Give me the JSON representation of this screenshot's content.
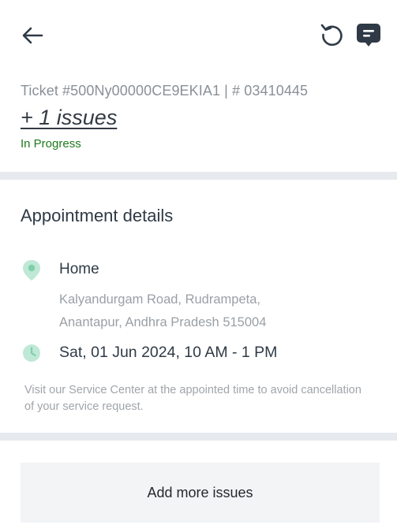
{
  "header": {
    "back_icon": "arrow-left-icon",
    "refresh_icon": "refresh-icon",
    "chat_icon": "chat-bubble-icon"
  },
  "ticket": {
    "id_text": "Ticket #500Ny00000CE9EKIA1 | # 03410445",
    "issues_link": "+ 1 issues",
    "status": "In Progress",
    "status_color": "#1c7a1c"
  },
  "appointment": {
    "title": "Appointment details",
    "location_icon": "location-pin-icon",
    "location_name": "Home",
    "address_line1": "Kalyandurgam Road, Rudrampeta,",
    "address_line2": "Anantapur, Andhra Pradesh 515004",
    "time_icon": "clock-icon",
    "time": "Sat, 01 Jun 2024, 10 AM - 1 PM",
    "notice": "Visit our Service Center at the appointed time to avoid cancellation of your service request.",
    "icon_color": "#bfe8d6"
  },
  "actions": {
    "add_more_issues": "Add more issues"
  }
}
